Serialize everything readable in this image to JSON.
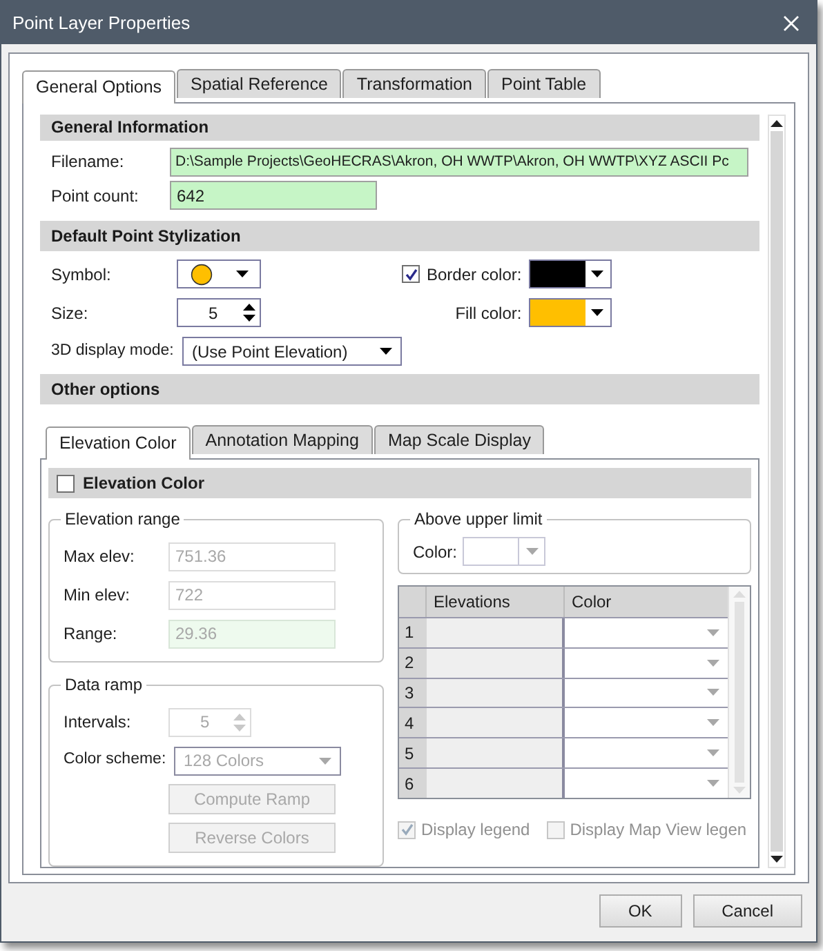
{
  "window": {
    "title": "Point Layer Properties"
  },
  "tabs": [
    {
      "label": "General Options",
      "selected": true
    },
    {
      "label": "Spatial Reference",
      "selected": false
    },
    {
      "label": "Transformation",
      "selected": false
    },
    {
      "label": "Point Table",
      "selected": false
    }
  ],
  "general_information": {
    "header": "General Information",
    "filename": {
      "label": "Filename:",
      "value": "D:\\Sample Projects\\GeoHECRAS\\Akron, OH WWTP\\Akron, OH WWTP\\XYZ ASCII Pc"
    },
    "point_count": {
      "label": "Point count:",
      "value": "642"
    }
  },
  "default_point_stylization": {
    "header": "Default Point Stylization",
    "symbol": {
      "label": "Symbol:",
      "color": "#ffbf00"
    },
    "size": {
      "label": "Size:",
      "value": "5"
    },
    "display_mode": {
      "label": "3D display mode:",
      "value": "(Use Point Elevation)"
    },
    "border_color": {
      "label": "Border color:",
      "checked": true,
      "color": "#000000"
    },
    "fill_color": {
      "label": "Fill color:",
      "color": "#ffbf00"
    }
  },
  "other_options": {
    "header": "Other options",
    "tabs": [
      {
        "label": "Elevation Color",
        "selected": true
      },
      {
        "label": "Annotation Mapping",
        "selected": false
      },
      {
        "label": "Map Scale Display",
        "selected": false
      }
    ],
    "elevation_color": {
      "label": "Elevation Color",
      "checked": false
    },
    "elevation_range": {
      "title": "Elevation range",
      "rows": [
        {
          "label": "Max elev:",
          "value": "751.36",
          "kind": "input"
        },
        {
          "label": "Min elev:",
          "value": "722",
          "kind": "input"
        },
        {
          "label": "Range:",
          "value": "29.36",
          "kind": "result"
        }
      ]
    },
    "data_ramp": {
      "title": "Data ramp",
      "intervals": {
        "label": "Intervals:",
        "value": "5"
      },
      "color_scheme": {
        "label": "Color scheme:",
        "value": "128 Colors"
      },
      "buttons": [
        {
          "label": "Compute Ramp",
          "disabled": true
        },
        {
          "label": "Reverse Colors",
          "disabled": true
        }
      ]
    },
    "above_upper_limit": {
      "title": "Above upper limit",
      "color_label": "Color:"
    },
    "table": {
      "columns": [
        "Elevations",
        "Color"
      ],
      "rows": [
        {
          "index": "1"
        },
        {
          "index": "2"
        },
        {
          "index": "3"
        },
        {
          "index": "4"
        },
        {
          "index": "5"
        },
        {
          "index": "6"
        }
      ]
    },
    "legend_options": [
      {
        "label": "Display legend",
        "checked": true
      },
      {
        "label": "Display Map View legen",
        "checked": false
      }
    ]
  },
  "buttons": [
    "OK",
    "Cancel"
  ]
}
